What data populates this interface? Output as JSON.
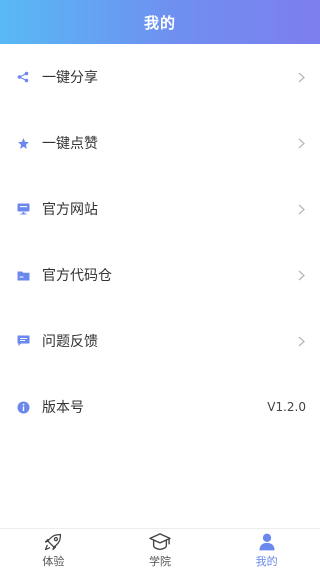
{
  "header": {
    "title": "我的"
  },
  "menu": [
    {
      "label": "一键分享",
      "icon": "share-icon"
    },
    {
      "label": "一键点赞",
      "icon": "star-icon"
    },
    {
      "label": "官方网站",
      "icon": "monitor-icon"
    },
    {
      "label": "官方代码仓",
      "icon": "folder-icon"
    },
    {
      "label": "问题反馈",
      "icon": "message-icon"
    },
    {
      "label": "版本号",
      "icon": "info-icon",
      "value": "V1.2.0"
    }
  ],
  "tabs": [
    {
      "label": "体验",
      "icon": "rocket-icon",
      "active": false
    },
    {
      "label": "学院",
      "icon": "graduation-cap-icon",
      "active": false
    },
    {
      "label": "我的",
      "icon": "user-icon",
      "active": true
    }
  ],
  "colors": {
    "accent": "#6a88ee",
    "header_gradient_start": "#58b9f5",
    "header_gradient_end": "#7d7eef",
    "chevron": "#b5b5b5"
  }
}
